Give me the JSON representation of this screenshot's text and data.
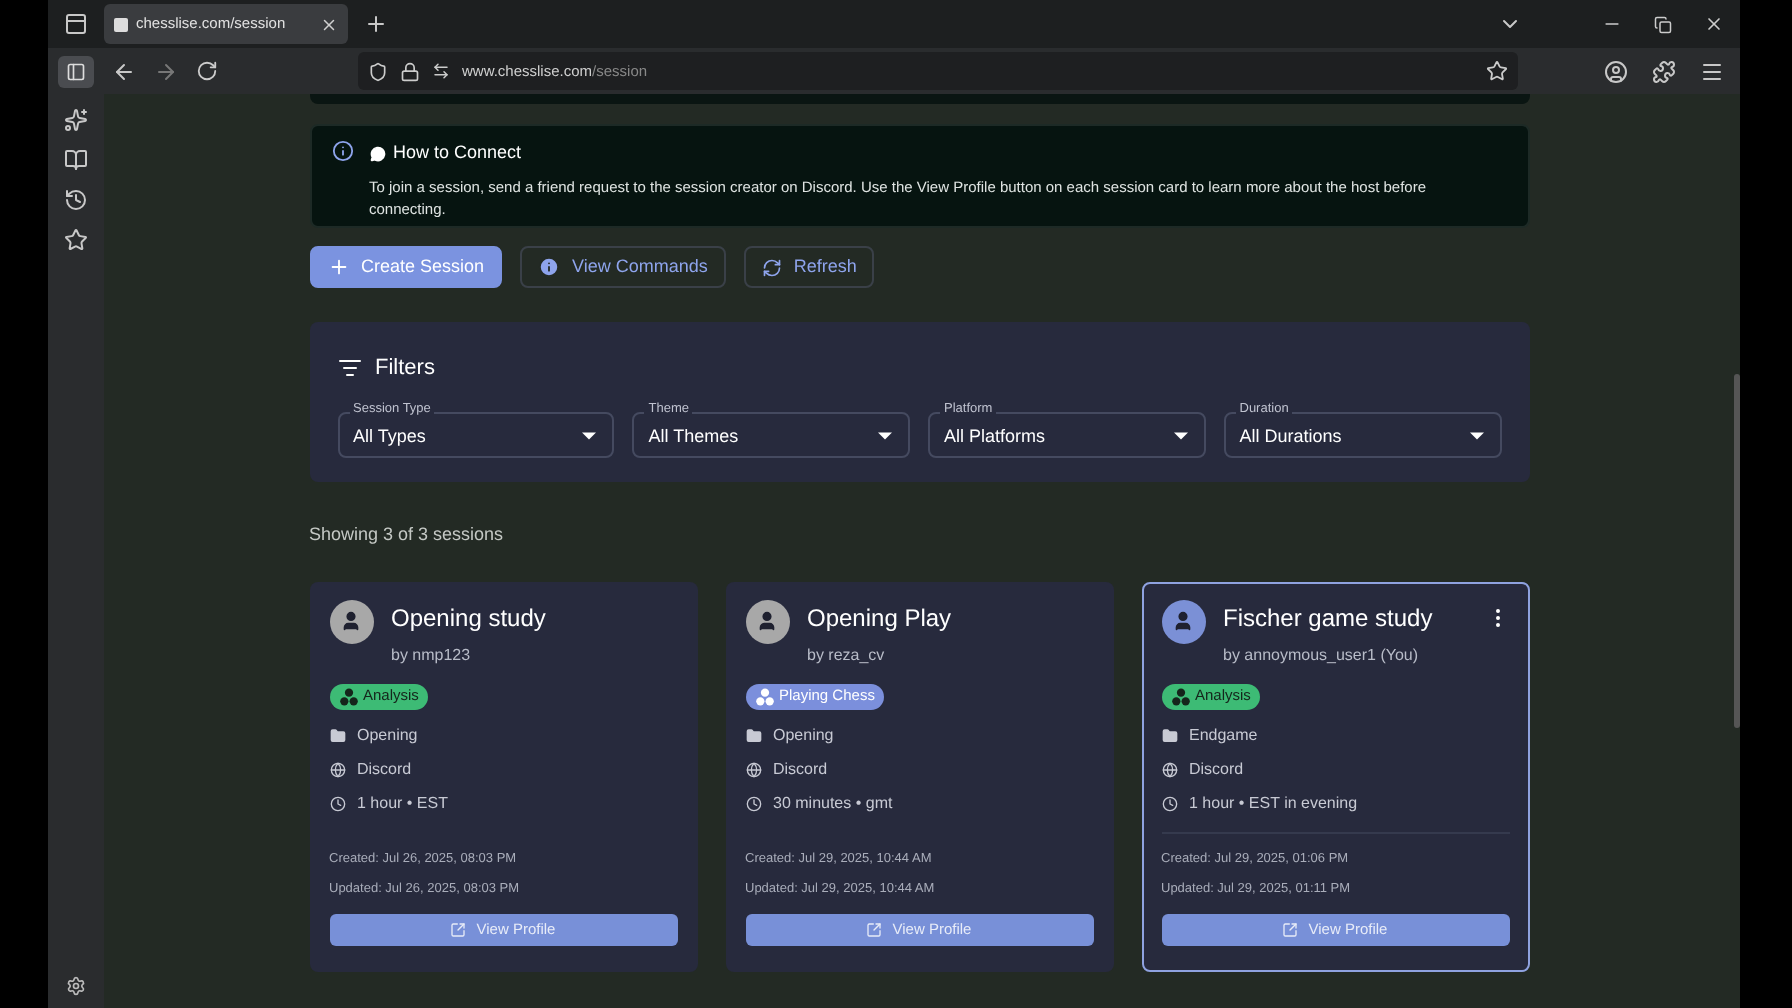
{
  "browser": {
    "tab_title": "chesslise.com/session",
    "url_host": "www.chesslise.com",
    "url_path": "/session"
  },
  "info": {
    "title": "How to Connect",
    "text": "To join a session, send a friend request to the session creator on Discord. Use the View Profile button on each session card to learn more about the host before connecting."
  },
  "actions": [
    {
      "label": "Create Session",
      "kind": "primary"
    },
    {
      "label": "View Commands",
      "kind": "info"
    },
    {
      "label": "Refresh",
      "kind": "refresh"
    }
  ],
  "filters": {
    "title": "Filters",
    "fields": [
      {
        "label": "Session Type",
        "value": "All Types"
      },
      {
        "label": "Theme",
        "value": "All Themes"
      },
      {
        "label": "Platform",
        "value": "All Platforms"
      },
      {
        "label": "Duration",
        "value": "All Durations"
      }
    ]
  },
  "summary": "Showing 3 of 3 sessions",
  "sessions": [
    {
      "title": "Opening study",
      "host": "by nmp123",
      "badge": {
        "label": "Analysis",
        "color": "#3dbb75"
      },
      "theme": "Opening",
      "platform": "Discord",
      "duration": "1 hour • EST",
      "created": "Created: Jul 26, 2025, 08:03 PM",
      "updated": "Updated: Jul 26, 2025, 08:03 PM",
      "button": "View Profile",
      "selected": false,
      "own": false
    },
    {
      "title": "Opening Play",
      "host": "by reza_cv",
      "badge": {
        "label": "Playing Chess",
        "color": "#7b8fdc"
      },
      "theme": "Opening",
      "platform": "Discord",
      "duration": "30 minutes • gmt",
      "created": "Created: Jul 29, 2025, 10:44 AM",
      "updated": "Updated: Jul 29, 2025, 10:44 AM",
      "button": "View Profile",
      "selected": false,
      "own": false
    },
    {
      "title": "Fischer game study",
      "host": "by annoymous_user1 (You)",
      "badge": {
        "label": "Analysis",
        "color": "#3dbb75"
      },
      "theme": "Endgame",
      "platform": "Discord",
      "duration": "1 hour • EST in evening",
      "created": "Created: Jul 29, 2025, 01:06 PM",
      "updated": "Updated: Jul 29, 2025, 01:11 PM",
      "button": "View Profile",
      "selected": true,
      "own": true
    }
  ]
}
